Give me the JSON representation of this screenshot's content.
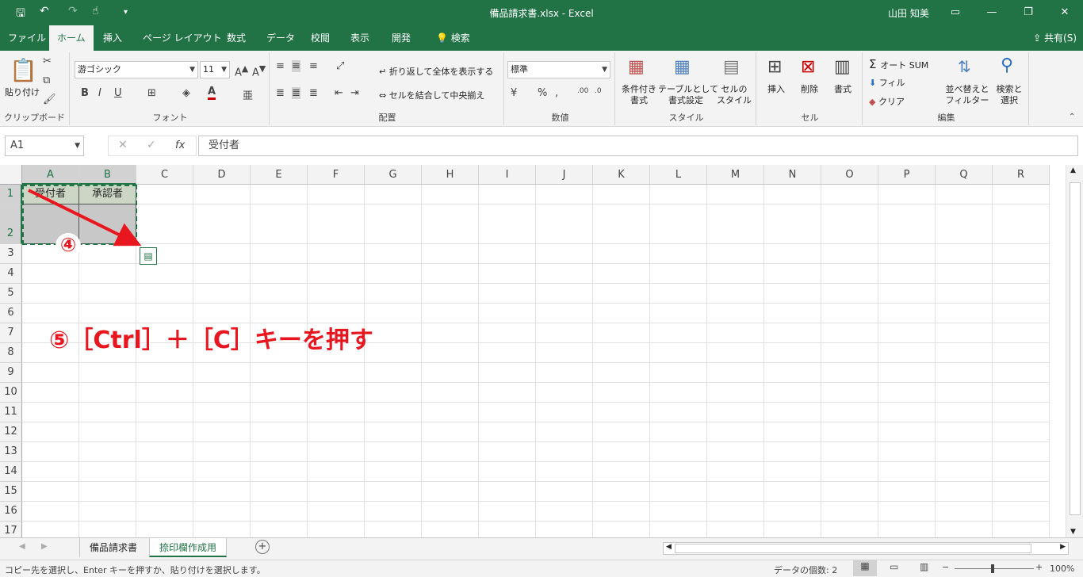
{
  "app": {
    "title": "備品請求書.xlsx  -  Excel",
    "user": "山田 知美",
    "window_min": "—",
    "window_restore": "❐",
    "window_close": "✕"
  },
  "tabs": [
    {
      "label": "ファイル"
    },
    {
      "label": "ホーム"
    },
    {
      "label": "挿入"
    },
    {
      "label": "ページ レイアウト"
    },
    {
      "label": "数式"
    },
    {
      "label": "データ"
    },
    {
      "label": "校閲"
    },
    {
      "label": "表示"
    },
    {
      "label": "開発"
    },
    {
      "label": "検索"
    }
  ],
  "share_label": "共有(S)",
  "ribbon": {
    "clipboard": {
      "paste": "貼り付け",
      "label": "クリップボード"
    },
    "font": {
      "name": "游ゴシック",
      "size": "11",
      "bold": "B",
      "italic": "I",
      "underline": "U",
      "label": "フォント"
    },
    "alignment": {
      "wrap": "折り返して全体を表示する",
      "merge": "セルを結合して中央揃え",
      "label": "配置"
    },
    "number": {
      "format": "標準",
      "percent": "%",
      "label": "数値"
    },
    "styles": {
      "cond": "条件付き\n書式",
      "table": "テーブルとして\n書式設定",
      "cell": "セルの\nスタイル",
      "label": "スタイル"
    },
    "cells": {
      "insert": "挿入",
      "delete": "削除",
      "format": "書式",
      "label": "セル"
    },
    "editing": {
      "autosum": "オート SUM",
      "fill": "フィル",
      "clear": "クリア",
      "sort": "並べ替えと\nフィルター",
      "find": "検索と\n選択",
      "label": "編集"
    }
  },
  "formula_bar": {
    "name_box": "A1",
    "content": "受付者"
  },
  "columns": [
    "A",
    "B",
    "C",
    "D",
    "E",
    "F",
    "G",
    "H",
    "I",
    "J",
    "K",
    "L",
    "M",
    "N",
    "O",
    "P",
    "Q",
    "R"
  ],
  "rows": [
    "1",
    "2",
    "3",
    "4",
    "5",
    "6",
    "7",
    "8",
    "9",
    "10",
    "11",
    "12",
    "13",
    "14",
    "15",
    "16",
    "17"
  ],
  "cells": {
    "A1": "受付者",
    "B1": "承認者"
  },
  "annotations": {
    "step4": "④",
    "step5": "⑤［Ctrl］＋［C］キーを押す"
  },
  "sheets": [
    {
      "label": "備品請求書"
    },
    {
      "label": "捺印欄作成用"
    }
  ],
  "status": {
    "message": "コピー先を選択し、Enter キーを押すか、貼り付けを選択します。",
    "count": "データの個数: 2",
    "zoom": "100%"
  },
  "colors": {
    "accent": "#217346",
    "annotation": "#e8171f",
    "header_fill": "#e2efda"
  }
}
